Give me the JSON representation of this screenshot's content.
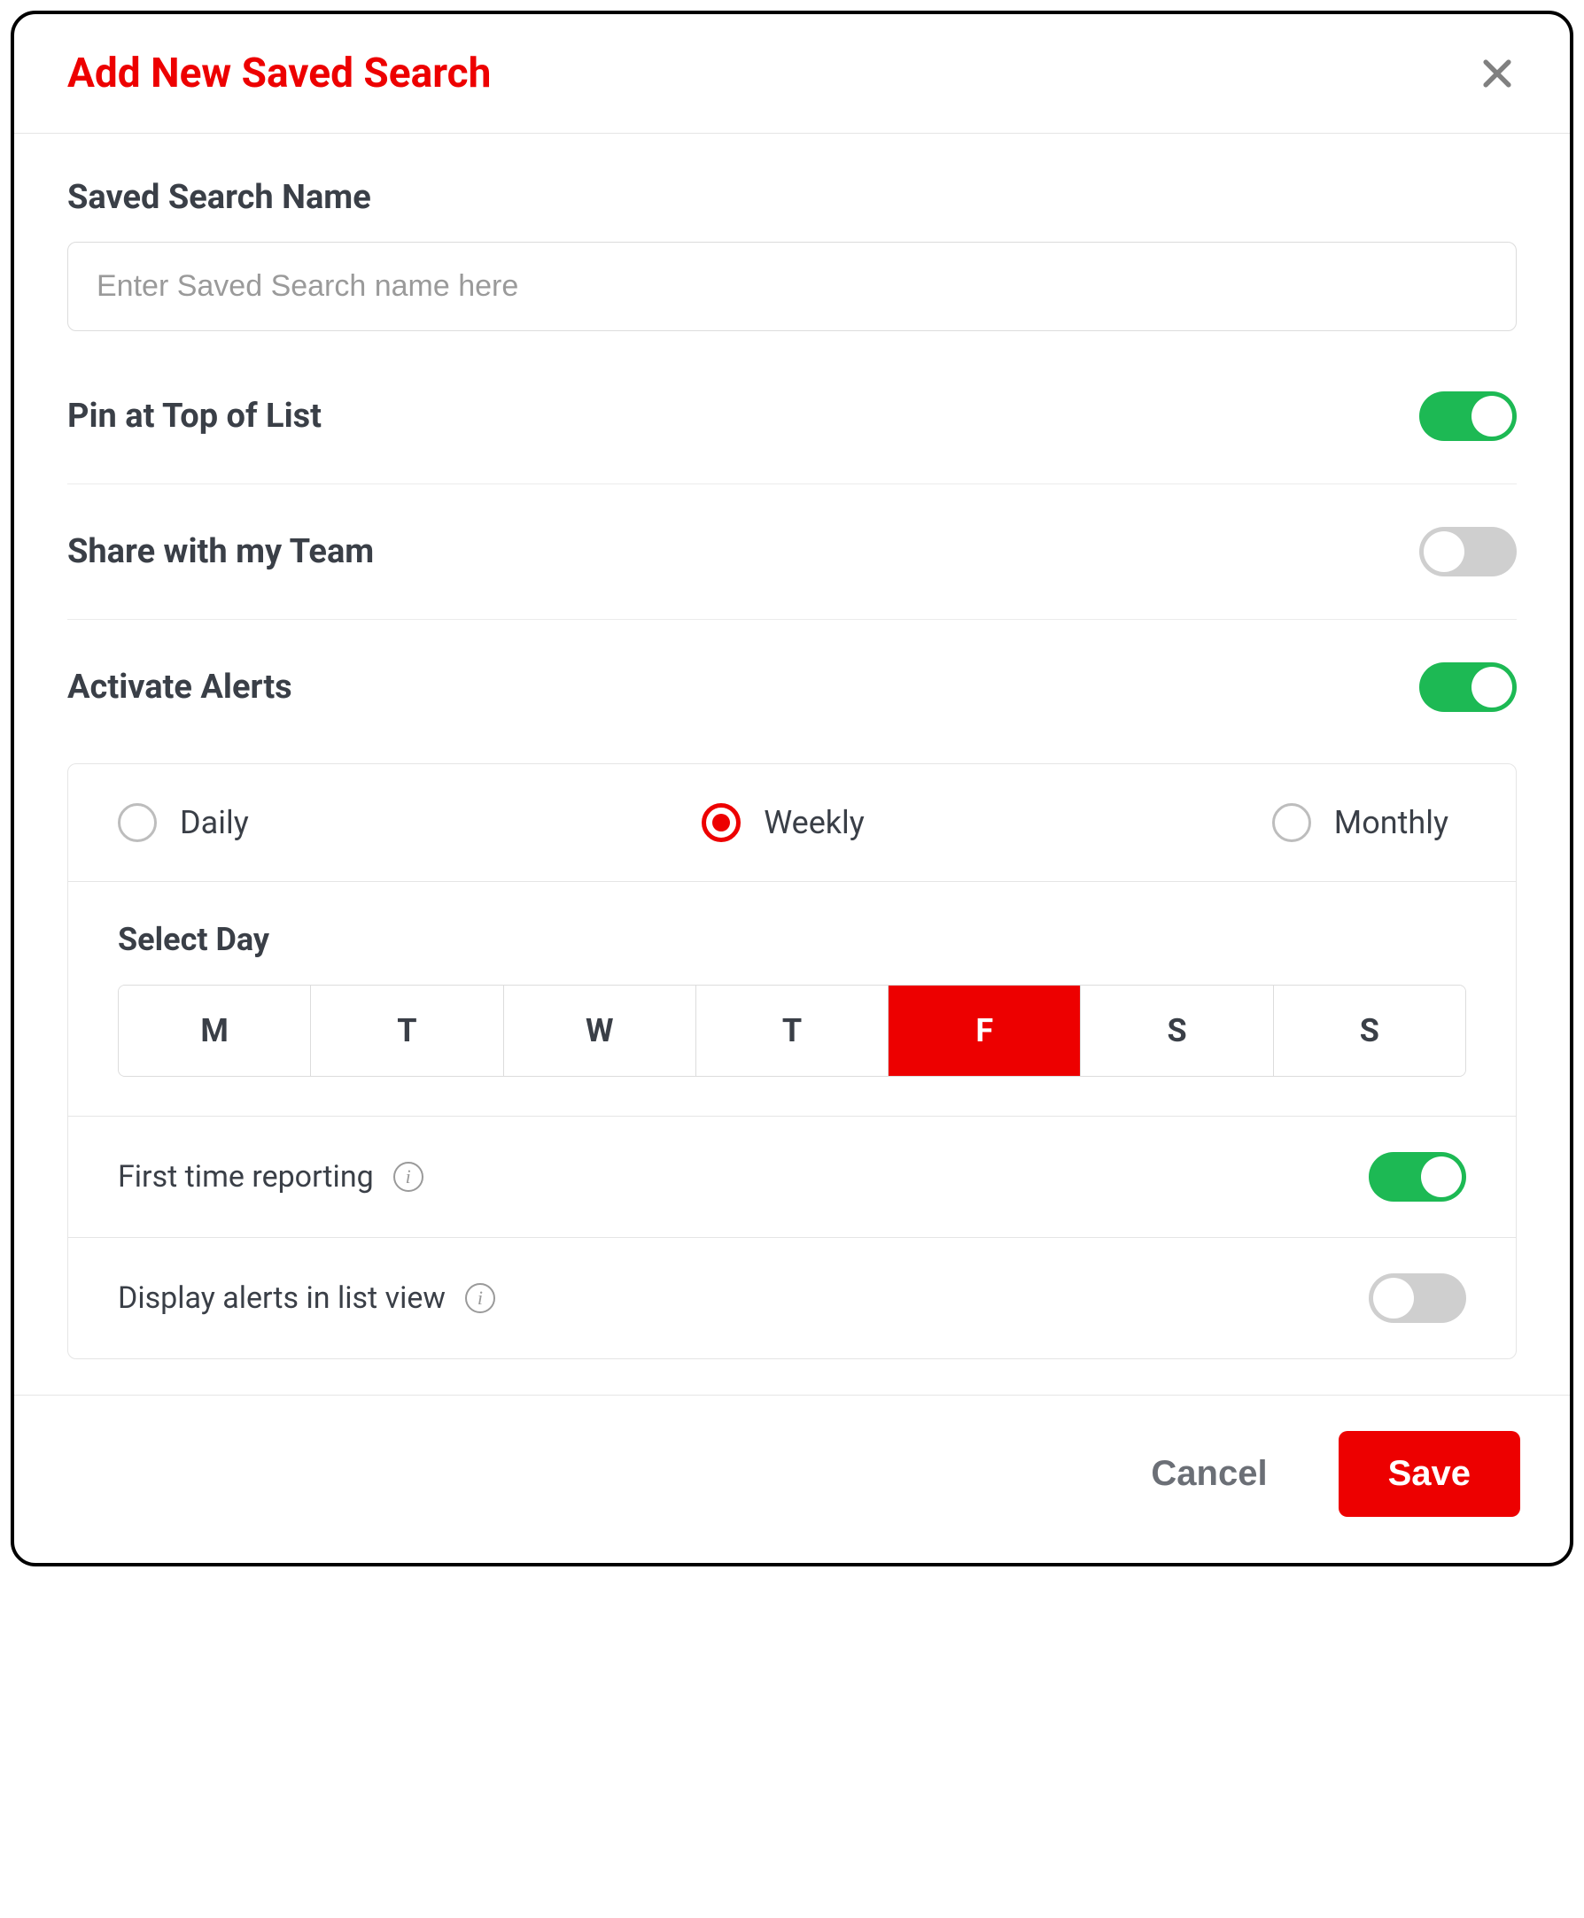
{
  "modal": {
    "title": "Add New Saved Search",
    "name_label": "Saved Search Name",
    "name_placeholder": "Enter Saved Search name here",
    "name_value": "",
    "pin_label": "Pin at Top of List",
    "pin_on": true,
    "share_label": "Share with my Team",
    "share_on": false,
    "alerts_label": "Activate Alerts",
    "alerts_on": true,
    "frequency": {
      "options": [
        {
          "label": "Daily",
          "selected": false
        },
        {
          "label": "Weekly",
          "selected": true
        },
        {
          "label": "Monthly",
          "selected": false
        }
      ]
    },
    "select_day_label": "Select Day",
    "days": [
      {
        "label": "M",
        "selected": false
      },
      {
        "label": "T",
        "selected": false
      },
      {
        "label": "W",
        "selected": false
      },
      {
        "label": "T",
        "selected": false
      },
      {
        "label": "F",
        "selected": true
      },
      {
        "label": "S",
        "selected": false
      },
      {
        "label": "S",
        "selected": false
      }
    ],
    "first_time_label": "First time reporting",
    "first_time_on": true,
    "display_list_label": "Display alerts in list view",
    "display_list_on": false,
    "cancel_label": "Cancel",
    "save_label": "Save"
  }
}
